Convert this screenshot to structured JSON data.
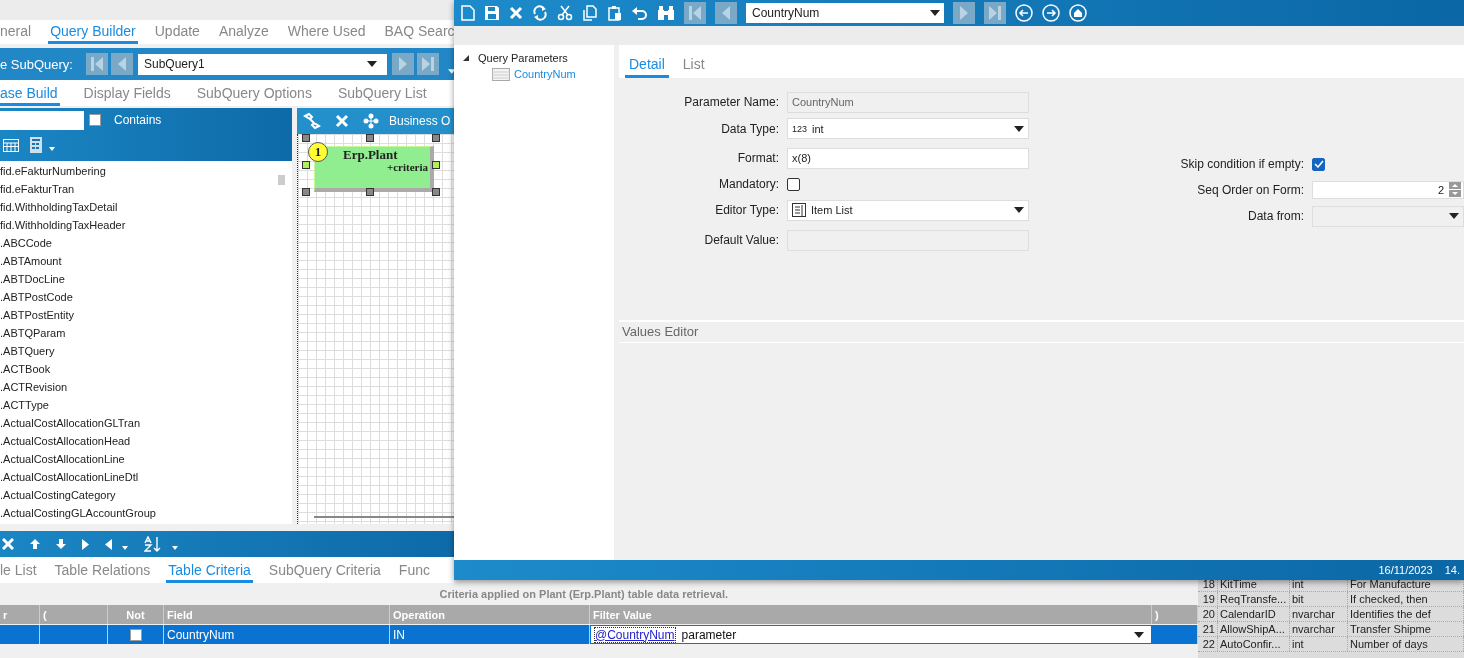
{
  "app": {
    "tabs": [
      {
        "label": "neral",
        "selected": false
      },
      {
        "label": "Query Builder",
        "selected": true
      },
      {
        "label": "Update",
        "selected": false
      },
      {
        "label": "Analyze",
        "selected": false
      },
      {
        "label": "Where Used",
        "selected": false
      },
      {
        "label": "BAQ Searc",
        "selected": false
      }
    ],
    "subquery": {
      "label": "e SubQuery:",
      "value": "SubQuery1"
    },
    "subtabs": [
      {
        "label": "ase Build",
        "selected": true
      },
      {
        "label": "Display Fields",
        "selected": false
      },
      {
        "label": "SubQuery Options",
        "selected": false
      },
      {
        "label": "SubQuery List",
        "selected": false
      }
    ],
    "table_list": {
      "filter_option": {
        "label": "Contains",
        "checked": false
      },
      "items": [
        "fid.eFakturNumbering",
        "fid.eFakturTran",
        "fid.WithholdingTaxDetail",
        "fid.WithholdingTaxHeader",
        ".ABCCode",
        ".ABTAmount",
        ".ABTDocLine",
        ".ABTPostCode",
        ".ABTPostEntity",
        ".ABTQParam",
        ".ABTQuery",
        ".ACTBook",
        ".ACTRevision",
        ".ACTType",
        ".ActualCostAllocationGLTran",
        ".ActualCostAllocationHead",
        ".ActualCostAllocationLine",
        ".ActualCostAllocationLineDtl",
        ".ActualCostingCategory",
        ".ActualCostingGLAccountGroup"
      ]
    },
    "diagram": {
      "toolbar_label": "Business O",
      "node": {
        "badge": "1",
        "title": "Erp.Plant",
        "note": "+criteria",
        "selected": true
      }
    },
    "bottom_tabs": [
      {
        "label": "le List",
        "selected": false
      },
      {
        "label": "Table Relations",
        "selected": false
      },
      {
        "label": "Table Criteria",
        "selected": true
      },
      {
        "label": "SubQuery Criteria",
        "selected": false
      },
      {
        "label": "Func",
        "selected": false
      }
    ],
    "criteria": {
      "caption": "Criteria applied on Plant (Erp.Plant)  table data retrieval.",
      "columns": [
        "r",
        "(",
        "Not",
        "Field",
        "Operation",
        "Filter Value",
        ")"
      ],
      "rows": [
        {
          "selected": true,
          "not": false,
          "field": "CountryNum",
          "operation": "IN",
          "filter_link": "@CountryNum",
          "filter_text": "parameter"
        }
      ]
    },
    "field_table": {
      "rows": [
        {
          "num": "18",
          "name": "KitTime",
          "type": "int",
          "description": "For Manufacture"
        },
        {
          "num": "19",
          "name": "ReqTransfe...",
          "type": "bit",
          "description": "If checked, then"
        },
        {
          "num": "20",
          "name": "CalendarID",
          "type": "nvarchar",
          "description": "Identifies the def"
        },
        {
          "num": "21",
          "name": "AllowShipA...",
          "type": "nvarchar",
          "description": "Transfer Shipme"
        },
        {
          "num": "22",
          "name": "AutoConfir...",
          "type": "int",
          "description": "Number of days"
        }
      ]
    }
  },
  "dialog": {
    "toolbar": {
      "record": "CountryNum"
    },
    "tree": {
      "label": "Query Parameters",
      "expanded": true,
      "children": [
        {
          "label": "CountryNum",
          "selected": true
        }
      ]
    },
    "tabs": [
      {
        "label": "Detail",
        "selected": true
      },
      {
        "label": "List",
        "selected": false
      }
    ],
    "form": {
      "left": [
        {
          "label": "Parameter Name:",
          "kind": "readonly",
          "value": "CountryNum"
        },
        {
          "label": "Data Type:",
          "kind": "dropdown",
          "prefix": "123",
          "value": "int"
        },
        {
          "label": "Format:",
          "kind": "text",
          "value": "x(8)"
        },
        {
          "label": "Mandatory:",
          "kind": "checkbox",
          "checked": false
        },
        {
          "label": "Editor Type:",
          "kind": "list_dropdown",
          "value": "Item List"
        },
        {
          "label": "Default Value:",
          "kind": "readonly"
        }
      ],
      "right": [
        {
          "label": "Skip condition if empty:",
          "kind": "checkbox",
          "checked": true
        },
        {
          "label": "Seq Order on Form:",
          "kind": "spinner",
          "value": "2"
        },
        {
          "label": "Data from:",
          "kind": "readonly_dropdown"
        }
      ]
    },
    "values_editor": {
      "title": "Values Editor"
    },
    "status_bar": {
      "date": "16/11/2023",
      "time": "14."
    }
  }
}
